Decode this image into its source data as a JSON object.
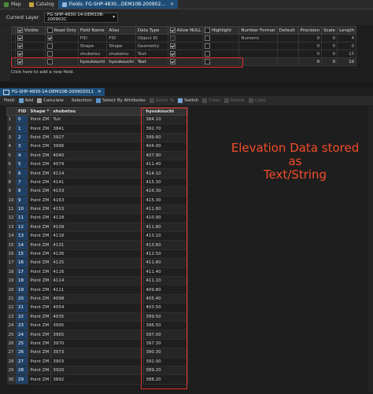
{
  "tabs": [
    {
      "label": "Map",
      "active": false,
      "icon": "map-icon"
    },
    {
      "label": "Catalog",
      "active": false,
      "icon": "catalog-icon"
    },
    {
      "label": "Fields: FG-SHP-4830...DEM10B-200902...",
      "active": true,
      "icon": "fields-icon"
    }
  ],
  "fields_view": {
    "current_layer_label": "Current Layer",
    "current_layer_value": "FG-SHP-4830-14-DEM10B-200902C",
    "columns": [
      "Visible",
      "Read Only",
      "Field Name",
      "Alias",
      "Data Type",
      "Allow NULL",
      "Highlight",
      "Number Format",
      "Default",
      "Precision",
      "Scale",
      "Length"
    ],
    "rows": [
      {
        "visible": true,
        "read_only": true,
        "field_name": "FID",
        "alias": "FID",
        "data_type": "Object ID",
        "allow_null": false,
        "highlight": false,
        "number_format": "Numeric",
        "default": "",
        "precision": "0",
        "scale": "0",
        "length": "4"
      },
      {
        "visible": true,
        "read_only": false,
        "field_name": "Shape",
        "alias": "Shape",
        "data_type": "Geometry",
        "allow_null": true,
        "highlight": false,
        "number_format": "",
        "default": "",
        "precision": "0",
        "scale": "0",
        "length": "0"
      },
      {
        "visible": true,
        "read_only": false,
        "field_name": "shubetsu",
        "alias": "shubetsu",
        "data_type": "Text",
        "allow_null": true,
        "highlight": false,
        "number_format": "",
        "default": "",
        "precision": "0",
        "scale": "0",
        "length": "15"
      },
      {
        "visible": true,
        "read_only": false,
        "field_name": "hyoukouchi",
        "alias": "hyoukouchi",
        "data_type": "Text",
        "allow_null": true,
        "highlight": false,
        "number_format": "",
        "default": "",
        "precision": "0",
        "scale": "0",
        "length": "10"
      }
    ],
    "add_field_text": "Click here to add a new field."
  },
  "table_tab": "FG-SHP-4830-14-DEM10B-200902011",
  "toolbar": {
    "field_label": "Field:",
    "add": "Add",
    "calculate": "Calculate",
    "selection_label": "Selection:",
    "select_by_attributes": "Select By Attributes",
    "zoom_to": "Zoom To",
    "switch": "Switch",
    "clear": "Clear",
    "delete": "Delete",
    "copy": "Copy"
  },
  "attr_table": {
    "columns": [
      "FID",
      "Shape *",
      "shubetsu",
      "hyoukouchi"
    ],
    "rows": [
      [
        "0",
        "Point ZM",
        "Tulr",
        "384.10"
      ],
      [
        "1",
        "Point ZM",
        "3841",
        "392.70"
      ],
      [
        "2",
        "Point ZM",
        "3927",
        "399.60"
      ],
      [
        "3",
        "Point ZM",
        "3996",
        "404.00"
      ],
      [
        "4",
        "Point ZM",
        "4040",
        "407.90"
      ],
      [
        "5",
        "Point ZM",
        "4079",
        "411.40"
      ],
      [
        "6",
        "Point ZM",
        "4114",
        "414.10"
      ],
      [
        "7",
        "Point ZM",
        "4141",
        "415.30"
      ],
      [
        "8",
        "Point ZM",
        "4153",
        "416.30"
      ],
      [
        "9",
        "Point ZM",
        "4163",
        "415.30"
      ],
      [
        "10",
        "Point ZM",
        "4153",
        "411.80"
      ],
      [
        "11",
        "Point ZM",
        "4118",
        "410.90"
      ],
      [
        "12",
        "Point ZM",
        "4109",
        "411.80"
      ],
      [
        "13",
        "Point ZM",
        "4118",
        "413.10"
      ],
      [
        "14",
        "Point ZM",
        "4131",
        "413.60"
      ],
      [
        "15",
        "Point ZM",
        "4136",
        "412.50"
      ],
      [
        "16",
        "Point ZM",
        "4125",
        "411.60"
      ],
      [
        "17",
        "Point ZM",
        "4116",
        "411.40"
      ],
      [
        "18",
        "Point ZM",
        "4114",
        "411.10"
      ],
      [
        "19",
        "Point ZM",
        "4111",
        "409.80"
      ],
      [
        "20",
        "Point ZM",
        "4098",
        "405.40"
      ],
      [
        "21",
        "Point ZM",
        "4054",
        "403.50"
      ],
      [
        "22",
        "Point ZM",
        "4035",
        "399.50"
      ],
      [
        "23",
        "Point ZM",
        "3995",
        "396.50"
      ],
      [
        "24",
        "Point ZM",
        "3965",
        "397.00"
      ],
      [
        "25",
        "Point ZM",
        "3970",
        "397.30"
      ],
      [
        "26",
        "Point ZM",
        "3973",
        "390.30"
      ],
      [
        "27",
        "Point ZM",
        "3903",
        "392.00"
      ],
      [
        "28",
        "Point ZM",
        "3920",
        "389.20"
      ],
      [
        "29",
        "Point ZM",
        "3892",
        "388.20"
      ]
    ]
  },
  "annotation": {
    "line1": "Elevation Data stored as",
    "line2": "Text/String",
    "color": "#f24c2a"
  },
  "colors": {
    "accent": "#1e4e78",
    "highlight_border": "#e0302e",
    "fid_cell": "#1f4066"
  }
}
